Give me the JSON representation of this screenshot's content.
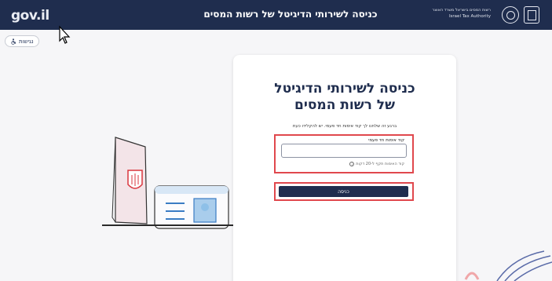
{
  "header": {
    "gov_logo": "gov.il",
    "title": "כניסה לשירותי הדיגיטל של רשות המסים",
    "authority_he": "רשות המסים בישראל משרד האוצר",
    "authority_en": "Israel Tax Authority"
  },
  "accessibility": {
    "label": "נגישות"
  },
  "login": {
    "title_line1": "כניסה לשירותי הדיגיטל",
    "title_line2": "של רשות המסים",
    "intro": "ברגע זה שלחנו לך קוד אימות חד פעמי. יש להקלידו כעת",
    "field_label": "קוד אימות חד פעמי",
    "input_value": "",
    "hint": "קוד האימות תקף ל-20 דקות",
    "submit_label": "כניסה"
  },
  "colors": {
    "header_bg": "#1f2d4e",
    "button_bg": "#1f2d4e",
    "highlight": "#e0484d"
  }
}
